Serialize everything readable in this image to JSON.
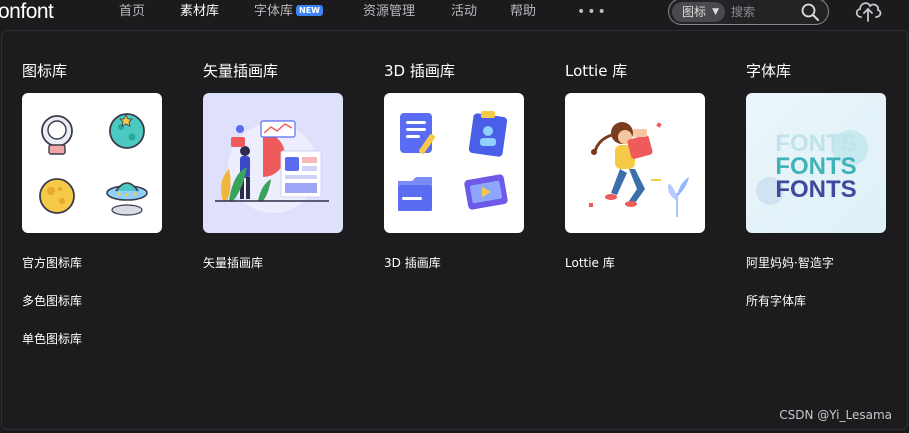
{
  "header": {
    "logo_text": "onfont",
    "nav": [
      {
        "label": "首页",
        "active": false
      },
      {
        "label": "素材库",
        "active": true
      },
      {
        "label": "字体库",
        "active": false,
        "badge": "NEW"
      },
      {
        "label": "资源管理",
        "active": false
      },
      {
        "label": "活动",
        "active": false
      },
      {
        "label": "帮助",
        "active": false
      }
    ],
    "more": "•••",
    "search": {
      "type": "图标",
      "placeholder": "搜索"
    }
  },
  "menu": {
    "columns": [
      {
        "title": "图标库",
        "card": "icon-library-illustration",
        "links": [
          "官方图标库",
          "多色图标库",
          "单色图标库"
        ]
      },
      {
        "title": "矢量插画库",
        "card": "vector-illustration",
        "links": [
          "矢量插画库"
        ]
      },
      {
        "title": "3D 插画库",
        "card": "3d-illustration",
        "links": [
          "3D 插画库"
        ]
      },
      {
        "title": "Lottie 库",
        "card": "lottie-illustration",
        "links": [
          "Lottie 库"
        ]
      },
      {
        "title": "字体库",
        "card": "fonts-illustration",
        "card_text": "FONTS",
        "links": [
          "阿里妈妈·智造字",
          "所有字体库"
        ]
      }
    ]
  },
  "watermark": "CSDN @Yi_Lesama",
  "colors": {
    "accent": "#3b82f6",
    "background": "#1c1c1e",
    "nav_text": "#b9b9bd"
  }
}
